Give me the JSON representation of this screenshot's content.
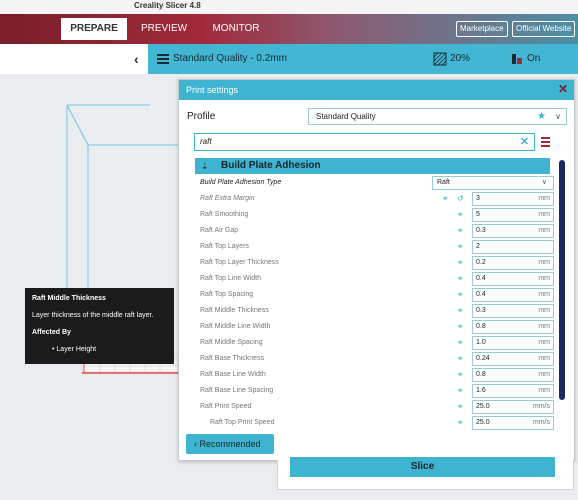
{
  "window": {
    "title": "Creality Slicer 4.8"
  },
  "nav": {
    "tabs": [
      {
        "label": "PREPARE",
        "active": true
      },
      {
        "label": "PREVIEW",
        "active": false
      },
      {
        "label": "MONITOR",
        "active": false
      }
    ],
    "marketplace_label": "Marketplace",
    "website_label": "Official Website"
  },
  "stage": {
    "quality_label": "Standard Quality - 0.2mm",
    "infill_label": "20%",
    "support_label": "On"
  },
  "panel": {
    "title": "Print settings",
    "profile_label": "Profile",
    "profile_value": "Standard Quality",
    "search_value": "raft",
    "category_label": "Build Plate Adhesion",
    "rows": [
      {
        "label": "Build Plate Adhesion Type",
        "type": "select",
        "value": "Raft"
      },
      {
        "label": "Raft Extra Margin",
        "value": "3",
        "unit": "mm"
      },
      {
        "label": "Raft Smoothing",
        "value": "5",
        "unit": "mm"
      },
      {
        "label": "Raft Air Gap",
        "value": "0.3",
        "unit": "mm"
      },
      {
        "label": "Raft Top Layers",
        "value": "2",
        "unit": ""
      },
      {
        "label": "Raft Top Layer Thickness",
        "value": "0.2",
        "unit": "mm"
      },
      {
        "label": "Raft Top Line Width",
        "value": "0.4",
        "unit": "mm"
      },
      {
        "label": "Raft Top Spacing",
        "value": "0.4",
        "unit": "mm"
      },
      {
        "label": "Raft Middle Thickness",
        "value": "0.3",
        "unit": "mm"
      },
      {
        "label": "Raft Middle Line Width",
        "value": "0.8",
        "unit": "mm"
      },
      {
        "label": "Raft Middle Spacing",
        "value": "1.0",
        "unit": "mm"
      },
      {
        "label": "Raft Base Thickness",
        "value": "0.24",
        "unit": "mm"
      },
      {
        "label": "Raft Base Line Width",
        "value": "0.8",
        "unit": "mm"
      },
      {
        "label": "Raft Base Line Spacing",
        "value": "1.6",
        "unit": "mm"
      },
      {
        "label": "Raft Print Speed",
        "value": "25.0",
        "unit": "mm/s"
      },
      {
        "label": "Raft Top Print Speed",
        "value": "25.0",
        "unit": "mm/s"
      }
    ],
    "recommended_label": "Recommended"
  },
  "slice_label": "Slice",
  "tooltip": {
    "title": "Raft Middle Thickness",
    "description": "Layer thickness of the middle raft layer.",
    "affected_by_label": "Affected By",
    "affected_items": [
      "Layer Height"
    ]
  },
  "colors": {
    "accent": "#3fb4d0",
    "brand_red": "#a12a3a",
    "scroll": "#1f2a5c"
  }
}
